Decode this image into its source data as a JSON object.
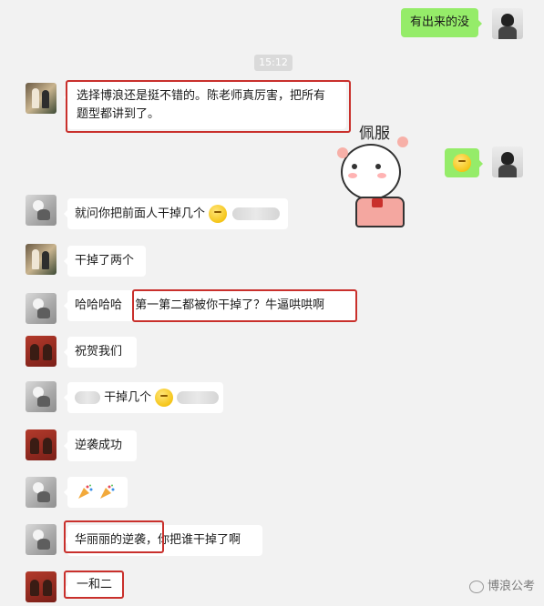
{
  "messages": {
    "m1": {
      "text": "有出来的没"
    },
    "timestamp": "15:12",
    "m2": {
      "line1": "选择博浪还是挺不错的。陈老师真厉害，把所有",
      "line2": "题型都讲到了。"
    },
    "sticker": {
      "caption": "佩服"
    },
    "m4": {
      "text": "就问你把前面人干掉几个",
      "emoji": "thinking-emoji"
    },
    "m5": {
      "text": "干掉了两个"
    },
    "m6": {
      "part1": "哈哈哈哈",
      "part2": "第一第二都被你干掉了？牛逼哄哄啊"
    },
    "m7": {
      "text": "祝贺我们"
    },
    "m8": {
      "text": "干掉几个",
      "emoji": "thinking-emoji"
    },
    "m9": {
      "text": "逆袭成功"
    },
    "m10": {
      "emoji": "party-popper-emoji"
    },
    "m11": {
      "part1": "华丽丽的逆袭",
      "part2": "，你把谁干掉了啊"
    },
    "m12": {
      "text": "一和二"
    }
  },
  "watermark": {
    "text": "博浪公考"
  },
  "colors": {
    "background": "#f2f2f2",
    "bubble_sent": "#95ec69",
    "bubble_received": "#ffffff",
    "highlight_box": "#c9302c"
  }
}
